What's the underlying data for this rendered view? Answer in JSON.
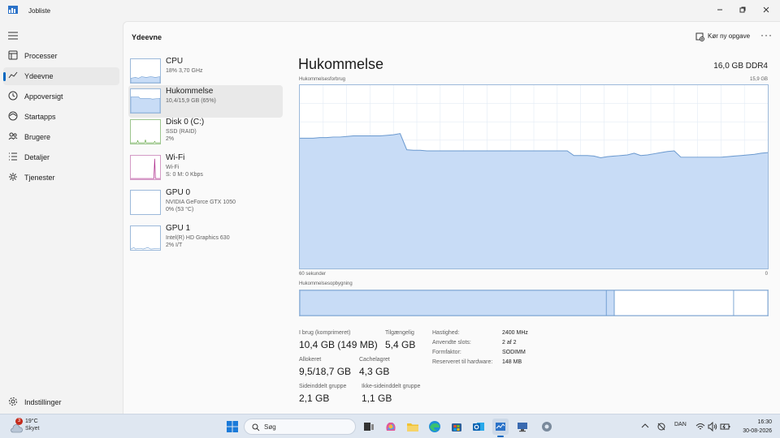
{
  "window": {
    "title": "Jobliste"
  },
  "sidebar": {
    "items": [
      {
        "label": "Processer",
        "icon": "processes-icon"
      },
      {
        "label": "Ydeevne",
        "icon": "performance-icon",
        "active": true
      },
      {
        "label": "Appoversigt",
        "icon": "app-history-icon"
      },
      {
        "label": "Startapps",
        "icon": "startup-apps-icon"
      },
      {
        "label": "Brugere",
        "icon": "users-icon"
      },
      {
        "label": "Detaljer",
        "icon": "details-icon"
      },
      {
        "label": "Tjenester",
        "icon": "services-icon"
      }
    ],
    "settings_label": "Indstillinger"
  },
  "header": {
    "title": "Ydeevne",
    "run_task_label": "Kør ny opgave",
    "more_label": "···"
  },
  "devices": [
    {
      "name": "CPU",
      "sub": [
        "18% 3,70 GHz"
      ]
    },
    {
      "name": "Hukommelse",
      "sub": [
        "10,4/15,9 GB (65%)"
      ],
      "active": true
    },
    {
      "name": "Disk 0 (C:)",
      "sub": [
        "SSD (RAID)",
        "2%"
      ]
    },
    {
      "name": "Wi-Fi",
      "sub": [
        "Wi-Fi",
        "S: 0 M: 0 Kbps"
      ]
    },
    {
      "name": "GPU 0",
      "sub": [
        "NVIDIA GeForce GTX 1050",
        "0% (53 °C)"
      ]
    },
    {
      "name": "GPU 1",
      "sub": [
        "Intel(R) HD Graphics 630",
        "2% I/T"
      ]
    }
  ],
  "memory": {
    "title": "Hukommelse",
    "capacity": "16,0 GB DDR4",
    "usage_label": "Hukommelsesforbrug",
    "usage_max": "15,9 GB",
    "time_left": "60 sekunder",
    "time_right": "0",
    "composition_label": "Hukommelsesopbygning",
    "stats": {
      "in_use_label": "I brug (komprimeret)",
      "in_use_value": "10,4 GB (149 MB)",
      "available_label": "Tilgængelig",
      "available_value": "5,4 GB",
      "committed_label": "Allokeret",
      "committed_value": "9,5/18,7 GB",
      "cached_label": "Cachelagret",
      "cached_value": "4,3 GB",
      "paged_label": "Sideinddelt gruppe",
      "paged_value": "2,1 GB",
      "nonpaged_label": "Ikke-sideinddelt gruppe",
      "nonpaged_value": "1,1 GB"
    },
    "specs": [
      {
        "key": "Hastighed:",
        "value": "2400 MHz"
      },
      {
        "key": "Anvendte slots:",
        "value": "2 af 2"
      },
      {
        "key": "Formfaktor:",
        "value": "SODIMM"
      },
      {
        "key": "Reserveret til hardware:",
        "value": "148 MB"
      }
    ],
    "composition": {
      "in_use_fraction": 0.655,
      "modified_fraction": 0.017,
      "standby_fraction": 0.255,
      "free_fraction": 0.073
    }
  },
  "chart_data": {
    "type": "area",
    "title": "Hukommelsesforbrug",
    "xlabel": "",
    "ylabel": "",
    "x_range_seconds": [
      60,
      0
    ],
    "ylim_gb": [
      0,
      15.9
    ],
    "series": [
      {
        "values": [
          11.3,
          11.3,
          11.3,
          11.35,
          11.35,
          11.4,
          11.4,
          11.45,
          11.5,
          11.5,
          11.5,
          11.5,
          11.5,
          11.55,
          11.6,
          11.7,
          10.3,
          10.25,
          10.25,
          10.2,
          10.2,
          10.2,
          10.2,
          10.2,
          10.2,
          10.2,
          10.2,
          10.2,
          10.2,
          10.2,
          10.2,
          10.2,
          10.2,
          10.2,
          10.2,
          10.2,
          10.2,
          10.2,
          10.2,
          10.2,
          10.2,
          9.8,
          9.8,
          9.8,
          9.75,
          9.6,
          9.7,
          9.75,
          9.8,
          9.85,
          10.0,
          9.8,
          9.85,
          9.95,
          10.05,
          10.15,
          10.2,
          9.65,
          9.65,
          9.65,
          9.65,
          9.65,
          9.65,
          9.65,
          9.7,
          9.75,
          9.8,
          9.85,
          9.9,
          10.0,
          10.05
        ]
      }
    ],
    "grid": true,
    "colors": {
      "fill": "#c8dcf6",
      "stroke": "#6a99cf",
      "grid": "#e3ebf5"
    }
  },
  "taskbar": {
    "weather_temp": "19°C",
    "weather_cond": "Skyet",
    "weather_badge": "3",
    "search_placeholder": "Søg",
    "language": "DAN",
    "time": "16:30",
    "date": "30-08-2026",
    "apps": [
      "start-icon",
      "task-view-icon",
      "copilot-icon",
      "file-explorer-icon",
      "edge-icon",
      "store-icon",
      "outlook-icon",
      "task-manager-icon",
      "remote-desktop-icon",
      "settings-app-icon"
    ]
  }
}
